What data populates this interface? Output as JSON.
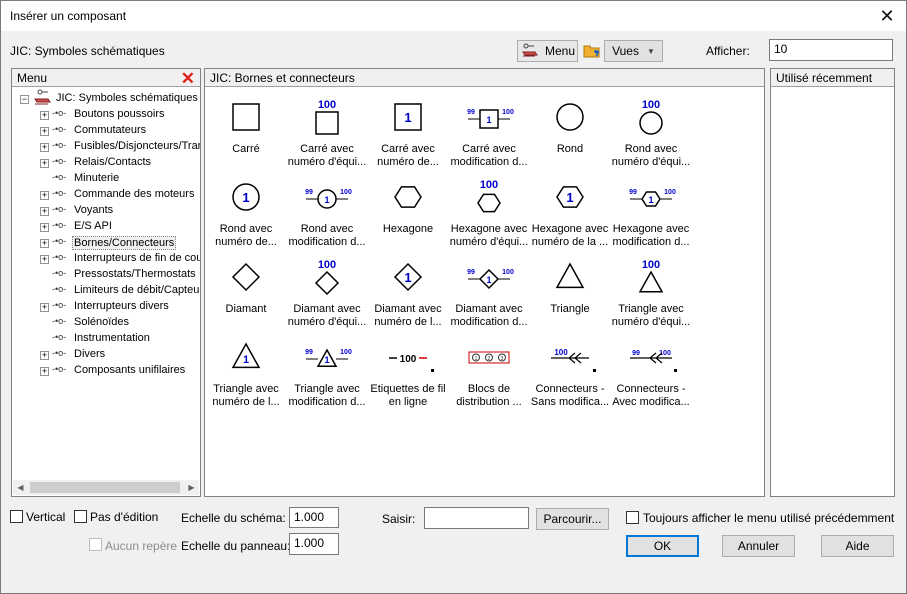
{
  "window": {
    "title": "Insérer un composant"
  },
  "topbar": {
    "library_label": "JIC: Symboles schématiques",
    "menu_button": "Menu",
    "views_button": "Vues",
    "show_label": "Afficher:",
    "show_value": "10"
  },
  "menu_panel": {
    "header": "Menu",
    "items": [
      {
        "label": "JIC: Symboles schématiques"
      },
      {
        "label": "Boutons poussoirs"
      },
      {
        "label": "Commutateurs"
      },
      {
        "label": "Fusibles/Disjoncteurs/Tran"
      },
      {
        "label": "Relais/Contacts"
      },
      {
        "label": "Minuterie"
      },
      {
        "label": "Commande des moteurs"
      },
      {
        "label": "Voyants"
      },
      {
        "label": "E/S API"
      },
      {
        "label": "Bornes/Connecteurs"
      },
      {
        "label": "Interrupteurs de fin de cour"
      },
      {
        "label": "Pressostats/Thermostats"
      },
      {
        "label": "Limiteurs de débit/Capteur"
      },
      {
        "label": "Interrupteurs divers"
      },
      {
        "label": "Solénoïdes"
      },
      {
        "label": "Instrumentation"
      },
      {
        "label": "Divers"
      },
      {
        "label": "Composants unifilaires"
      }
    ]
  },
  "symbols_panel": {
    "header": "JIC: Bornes et connecteurs",
    "symbols": [
      {
        "l1": "Carré",
        "l2": "",
        "tag": ""
      },
      {
        "l1": "Carré avec",
        "l2": "numéro d'équi...",
        "tag": "100"
      },
      {
        "l1": "Carré avec",
        "l2": "numéro de...",
        "tag": "1"
      },
      {
        "l1": "Carré avec",
        "l2": "modification d...",
        "tag": "99",
        "tag2": "100",
        "tag3": "1"
      },
      {
        "l1": "Rond",
        "l2": "",
        "tag": ""
      },
      {
        "l1": "Rond avec",
        "l2": "numéro d'équi...",
        "tag": "100"
      },
      {
        "l1": "Rond avec",
        "l2": "numéro de...",
        "tag": "1"
      },
      {
        "l1": "Rond avec",
        "l2": "modification d...",
        "tag": "99",
        "tag2": "100",
        "tag3": "1"
      },
      {
        "l1": "Hexagone",
        "l2": "",
        "tag": ""
      },
      {
        "l1": "Hexagone avec",
        "l2": "numéro d'équi...",
        "tag": "100"
      },
      {
        "l1": "Hexagone avec",
        "l2": "numéro de la ...",
        "tag": "1"
      },
      {
        "l1": "Hexagone avec",
        "l2": "modification d...",
        "tag": "99",
        "tag2": "100",
        "tag3": "1"
      },
      {
        "l1": "Diamant",
        "l2": "",
        "tag": ""
      },
      {
        "l1": "Diamant avec",
        "l2": "numéro d'équi...",
        "tag": "100"
      },
      {
        "l1": "Diamant avec",
        "l2": "numéro de l...",
        "tag": "1"
      },
      {
        "l1": "Diamant avec",
        "l2": "modification d...",
        "tag": "99",
        "tag2": "100",
        "tag3": "1"
      },
      {
        "l1": "Triangle",
        "l2": "",
        "tag": ""
      },
      {
        "l1": "Triangle avec",
        "l2": "numéro d'équi...",
        "tag": "100"
      },
      {
        "l1": "Triangle avec",
        "l2": "numéro de l...",
        "tag": "1"
      },
      {
        "l1": "Triangle avec",
        "l2": "modification d...",
        "tag": "99",
        "tag2": "100",
        "tag3": "1"
      },
      {
        "l1": "Etiquettes de fil",
        "l2": "en ligne",
        "tag": "100"
      },
      {
        "l1": "Blocs de",
        "l2": "distribution ...",
        "tag": "1",
        "tag2": "2",
        "tag3": "3"
      },
      {
        "l1": "Connecteurs -",
        "l2": "Sans modifica...",
        "tag": "100"
      },
      {
        "l1": "Connecteurs -",
        "l2": "Avec modifica...",
        "tag": "99",
        "tag2": "100"
      }
    ]
  },
  "recent_panel": {
    "header": "Utilisé récemment"
  },
  "bottom": {
    "vertical": "Vertical",
    "no_edit": "Pas d'édition",
    "no_marker": "Aucun repère",
    "scale_schema_label": "Echelle du schéma:",
    "scale_schema_value": "1.000",
    "scale_panel_label": "Echelle du panneau:",
    "scale_panel_value": "1.000",
    "input_label": "Saisir:",
    "input_value": "",
    "browse": "Parcourir...",
    "always_show": "Toujours afficher le menu utilisé précédemment",
    "ok": "OK",
    "cancel": "Annuler",
    "help": "Aide"
  },
  "colors": {
    "accent": "#0078d7",
    "symbol_blue": "#0000cc",
    "red": "#e0201a"
  }
}
